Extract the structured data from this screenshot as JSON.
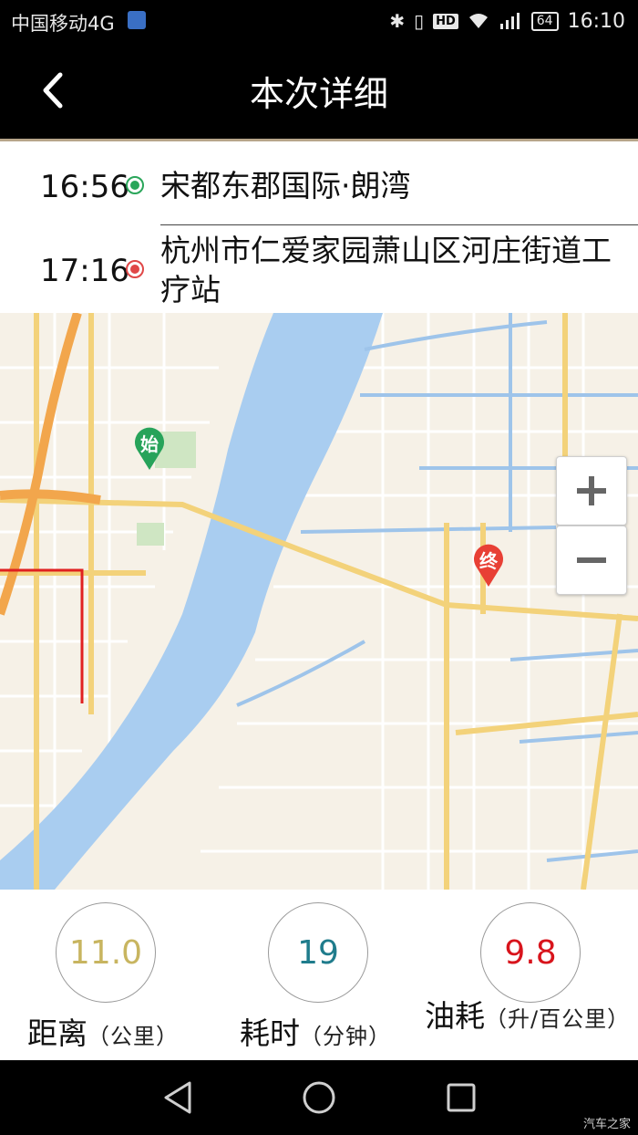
{
  "status_bar": {
    "carrier": "中国移动4G",
    "network": "4G",
    "battery": "64",
    "time": "16:10"
  },
  "header": {
    "title": "本次详细",
    "back_icon": "chevron-left-icon"
  },
  "trip": {
    "start": {
      "time": "16:56",
      "place": "宋都东郡国际·朗湾",
      "color": "#2aa65a"
    },
    "end": {
      "time": "17:16",
      "place": "杭州市仁爱家园萧山区河庄街道工疗站",
      "color": "#e04747"
    }
  },
  "map": {
    "start_marker": "始",
    "end_marker": "终",
    "start_color": "#27a35a",
    "end_color": "#e84035",
    "zoom_in_icon": "plus-icon",
    "zoom_out_icon": "minus-icon"
  },
  "stats": [
    {
      "value": "11.0",
      "label": "距离",
      "unit": "（公里）",
      "color": "#c8b560"
    },
    {
      "value": "19",
      "label": "耗时",
      "unit": "（分钟）",
      "color": "#1f7c8c"
    },
    {
      "value": "9.8",
      "label": "油耗",
      "unit": "（升/百公里）",
      "color": "#d8141c"
    }
  ],
  "nav_bar": {
    "watermark": "汽车之家"
  }
}
